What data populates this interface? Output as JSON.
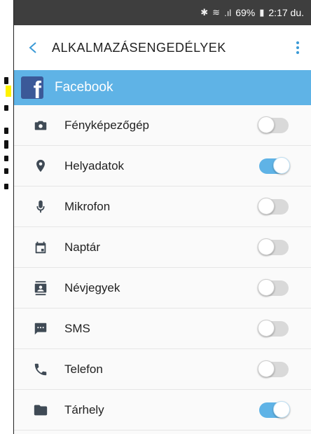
{
  "statusbar": {
    "bluetooth_icon": "✱",
    "wifi_icon": "≋",
    "signal_icon": ".ıl",
    "battery_percent": "69%",
    "battery_icon": "▮",
    "time": "2:17 du."
  },
  "header": {
    "title": "ALKALMAZÁSENGEDÉLYEK"
  },
  "app": {
    "name": "Facebook",
    "logo_letter": "f"
  },
  "permissions": [
    {
      "label": "Fényképezőgép",
      "icon": "camera-icon",
      "enabled": false
    },
    {
      "label": "Helyadatok",
      "icon": "location-icon",
      "enabled": true
    },
    {
      "label": "Mikrofon",
      "icon": "microphone-icon",
      "enabled": false
    },
    {
      "label": "Naptár",
      "icon": "calendar-icon",
      "enabled": false
    },
    {
      "label": "Névjegyek",
      "icon": "contacts-icon",
      "enabled": false
    },
    {
      "label": "SMS",
      "icon": "sms-icon",
      "enabled": false
    },
    {
      "label": "Telefon",
      "icon": "phone-icon",
      "enabled": false
    },
    {
      "label": "Tárhely",
      "icon": "folder-icon",
      "enabled": true
    }
  ],
  "colors": {
    "accent": "#5fb3e6",
    "statusbar": "#3e3e3e",
    "facebook": "#3b5998"
  }
}
